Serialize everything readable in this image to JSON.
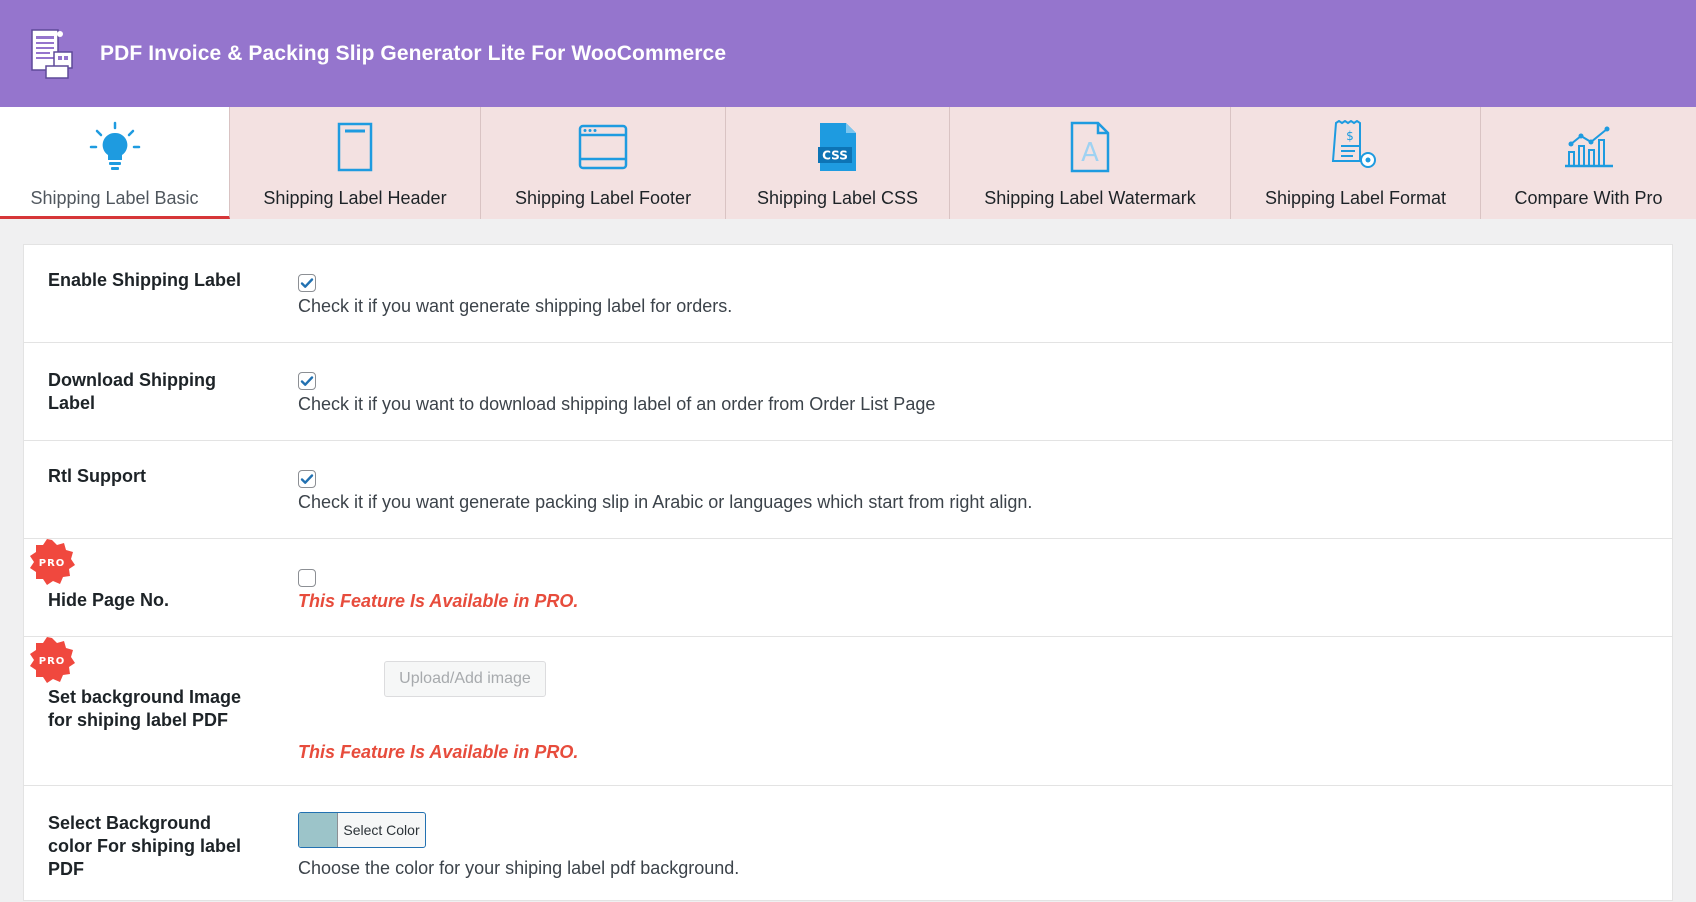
{
  "app": {
    "title": "PDF Invoice & Packing Slip Generator Lite For WooCommerce",
    "accent": "#9575cd"
  },
  "tabs": [
    {
      "label": "Shipping Label Basic",
      "icon": "lightbulb-icon",
      "active": true
    },
    {
      "label": "Shipping Label Header",
      "icon": "page-header-icon",
      "active": false
    },
    {
      "label": "Shipping Label Footer",
      "icon": "browser-window-icon",
      "active": false
    },
    {
      "label": "Shipping Label CSS",
      "icon": "css-file-icon",
      "active": false
    },
    {
      "label": "Shipping Label Watermark",
      "icon": "watermark-icon",
      "active": false
    },
    {
      "label": "Shipping Label Format",
      "icon": "invoice-settings-icon",
      "active": false
    },
    {
      "label": "Compare With Pro",
      "icon": "chart-icon",
      "active": false
    }
  ],
  "settings": {
    "enable": {
      "label": "Enable Shipping Label",
      "checked": true,
      "description": "Check it if you want generate shipping label for orders."
    },
    "download": {
      "label": "Download Shipping Label",
      "checked": true,
      "description": "Check it if you want to download shipping label of an order from Order List Page"
    },
    "rtl": {
      "label": "Rtl Support",
      "checked": true,
      "description": "Check it if you want generate packing slip in Arabic or languages which start from right align."
    },
    "hide_page_no": {
      "label": "Hide Page No.",
      "checked": false,
      "badge": "PRO",
      "pro_note": "This Feature Is Available in PRO."
    },
    "bg_image": {
      "label": "Set background Image for shiping label PDF",
      "badge": "PRO",
      "button": "Upload/Add image",
      "pro_note": "This Feature Is Available in PRO."
    },
    "bg_color": {
      "label": "Select Background color For shiping label PDF",
      "button": "Select Color",
      "swatch": "#9cc4c9",
      "description": "Choose the color for your shiping label pdf background."
    }
  }
}
